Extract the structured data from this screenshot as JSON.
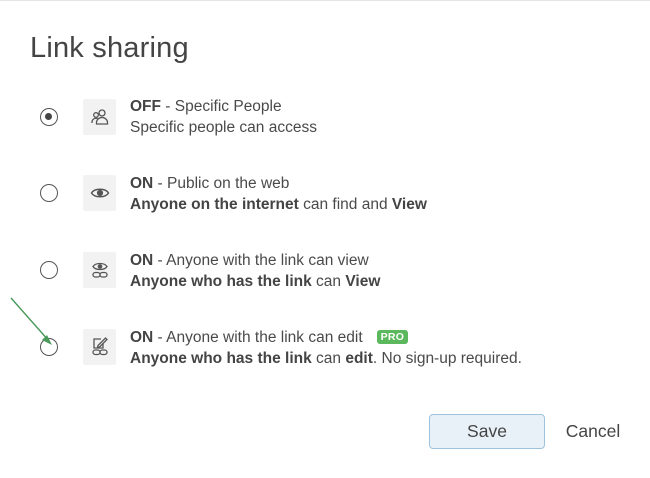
{
  "dialog": {
    "title": "Link sharing"
  },
  "options": [
    {
      "selected": true,
      "icon": "people-icon",
      "line1_bold": "OFF",
      "line1_rest": " - Specific People",
      "line2_plain": "Specific people can access"
    },
    {
      "selected": false,
      "icon": "eye-icon",
      "line1_bold": "ON",
      "line1_rest": " - Public on the web",
      "line2_bold_a": "Anyone on the internet",
      "line2_mid": " can find and ",
      "line2_bold_b": "View"
    },
    {
      "selected": false,
      "icon": "eye-link-icon",
      "line1_bold": "ON",
      "line1_rest": " - Anyone with the link can view",
      "line2_bold_a": "Anyone who has the link",
      "line2_mid": " can ",
      "line2_bold_b": "View"
    },
    {
      "selected": false,
      "icon": "edit-link-icon",
      "line1_bold": "ON",
      "line1_rest": " - Anyone with the link can edit",
      "badge": "PRO",
      "line2_bold_a": "Anyone who has the link",
      "line2_mid": " can ",
      "line2_bold_b": "edit",
      "line2_tail": ". No sign-up required."
    }
  ],
  "buttons": {
    "save_label": "Save",
    "cancel_label": "Cancel"
  },
  "colors": {
    "badge_bg": "#5cb85c",
    "save_bg": "#e8f1f8",
    "save_border": "#9ec3de",
    "annotation_arrow": "#4a9a5c"
  }
}
